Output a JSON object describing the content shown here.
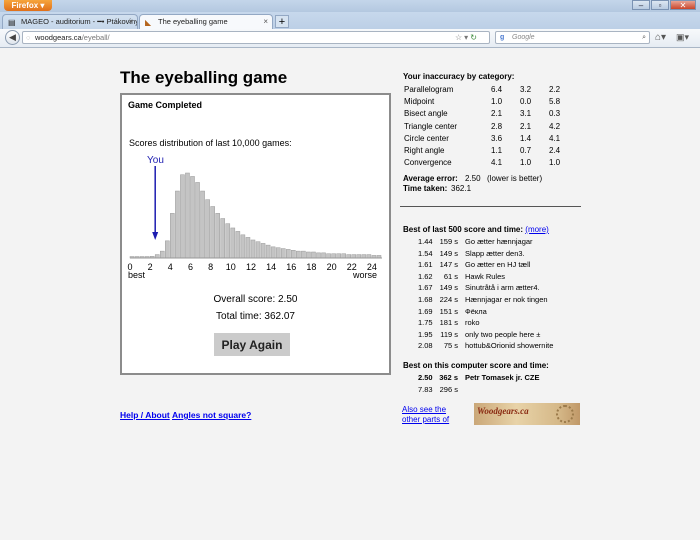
{
  "browser": {
    "app_button": "Firefox",
    "tabs": [
      {
        "label": "MAGEO - auditorium - ━• Ptákoviny...",
        "active": false
      },
      {
        "label": "The eyeballing game",
        "active": true
      }
    ],
    "url_domain": "woodgears.ca",
    "url_path": "/eyeball/",
    "search_engine": "Google",
    "search_placeholder": "Google"
  },
  "page": {
    "title": "The eyeballing game",
    "status": "Game Completed",
    "distribution_title": "Scores distribution of last 10,000 games:",
    "you_label": "You",
    "overall_score": "Overall score: 2.50",
    "total_time": "Total time: 362.07",
    "play_again": "Play Again",
    "links": {
      "help": "Help / About",
      "angles": "Angles not square?",
      "also": "Also see the other parts of",
      "more": "(more)"
    },
    "logo_text": "Woodgears.ca"
  },
  "chart_data": {
    "type": "bar",
    "title": "Scores distribution of last 10,000 games:",
    "xlabel": "",
    "ylabel": "",
    "xlim": [
      0,
      25
    ],
    "x_ticks": [
      "0",
      "2",
      "4",
      "6",
      "8",
      "10",
      "12",
      "14",
      "16",
      "18",
      "20",
      "22",
      "24"
    ],
    "x_axis_left_label": "best",
    "x_axis_right_label": "worse",
    "bin_width": 0.5,
    "marker": {
      "label": "You",
      "x": 2.5
    },
    "values": [
      0,
      0,
      0.5,
      1,
      2,
      4,
      8,
      20,
      52,
      78,
      97,
      99,
      95,
      88,
      78,
      68,
      60,
      52,
      46,
      40,
      35,
      31,
      27,
      24,
      21,
      19,
      17,
      15,
      13,
      12,
      11,
      10,
      9,
      8,
      8,
      7,
      7,
      6,
      6,
      5,
      5,
      5,
      5,
      4,
      4,
      4,
      4,
      4,
      3,
      3
    ]
  },
  "inaccuracy": {
    "title": "Your inaccuracy by category:",
    "rows": [
      {
        "name": "Parallelogram",
        "v1": "6.4",
        "v2": "3.2",
        "v3": "2.2"
      },
      {
        "name": "Midpoint",
        "v1": "1.0",
        "v2": "0.0",
        "v3": "5.8"
      },
      {
        "name": "Bisect angle",
        "v1": "2.1",
        "v2": "3.1",
        "v3": "0.3"
      },
      {
        "name": "Triangle center",
        "v1": "2.8",
        "v2": "2.1",
        "v3": "4.2"
      },
      {
        "name": "Circle center",
        "v1": "3.6",
        "v2": "1.4",
        "v3": "4.1"
      },
      {
        "name": "Right angle",
        "v1": "1.1",
        "v2": "0.7",
        "v3": "2.4"
      },
      {
        "name": "Convergence",
        "v1": "4.1",
        "v2": "1.0",
        "v3": "1.0"
      }
    ],
    "avg_label": "Average error:",
    "avg_value": "2.50",
    "avg_note": "(lower is better)",
    "time_label": "Time taken:",
    "time_value": "362.1"
  },
  "best500": {
    "title": "Best of last 500 score and time:",
    "rows": [
      {
        "score": "1.44",
        "time": "159 s",
        "name": "Go ætter hænnjagar"
      },
      {
        "score": "1.54",
        "time": "149 s",
        "name": "Slapp ætter den3."
      },
      {
        "score": "1.61",
        "time": "147 s",
        "name": "Go ætter en HJ tæll"
      },
      {
        "score": "1.62",
        "time": "61 s",
        "name": "Hawk Rules"
      },
      {
        "score": "1.67",
        "time": "149 s",
        "name": "Sinutråtå i arm ætter4."
      },
      {
        "score": "1.68",
        "time": "224 s",
        "name": "Hænnjagar er nok tingen"
      },
      {
        "score": "1.69",
        "time": "151 s",
        "name": "Фёкла"
      },
      {
        "score": "1.75",
        "time": "181 s",
        "name": "roko"
      },
      {
        "score": "1.95",
        "time": "119 s",
        "name": "  only two people here ±"
      },
      {
        "score": "2.08",
        "time": "75 s",
        "name": "hottub&Orionid showernite"
      }
    ]
  },
  "best_computer": {
    "title": "Best on this computer score and time:",
    "rows": [
      {
        "score": "2.50",
        "time": "362 s",
        "name": "Petr Tomasek jr. CZE"
      },
      {
        "score": "7.83",
        "time": "296 s",
        "name": ""
      }
    ]
  }
}
